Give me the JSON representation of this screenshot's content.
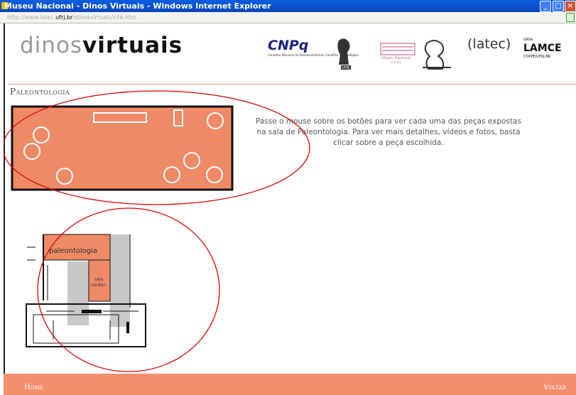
{
  "window": {
    "title": "Museu Nacional - Dinos Virtuais - Windows Internet Explorer",
    "url_prefix": "http://www.latec.",
    "url_domain": "ufrj.br",
    "url_suffix": "/dinosvirtuais/site.htm"
  },
  "header": {
    "logo_part1": "dinos",
    "logo_part2": "virtuais",
    "sponsors": {
      "cnpq": "CNPq",
      "cnpq_sub": "Conselho Nacional de Desenvolvimento Científico e Tecnológico",
      "ufrj": "UFRJ",
      "museu": "Museu Nacional",
      "museu_sub": "U F R J",
      "latec": "(latec)",
      "lamce_top": "GRVa",
      "lamce": "LAMCE",
      "lamce_sub": "COPPE/UFRJ.BR"
    }
  },
  "section": {
    "title": "Paleontologia"
  },
  "info": {
    "text": "Passe o mouse sobre os botões para ver cada uma das peças expostas na sala de Paleontologia. Para ver mais detalhes, vídeos e fotos, basta clicar sobre a peça escolhida."
  },
  "floorplan": {
    "room_label": "paleontologia",
    "side_label_1": "sala",
    "side_label_2": "rondon"
  },
  "footer": {
    "home": "Home",
    "back": "Voltar"
  },
  "colors": {
    "accent": "#f28f6c",
    "room_fill": "#ef8a67",
    "annotation": "#e00000"
  }
}
